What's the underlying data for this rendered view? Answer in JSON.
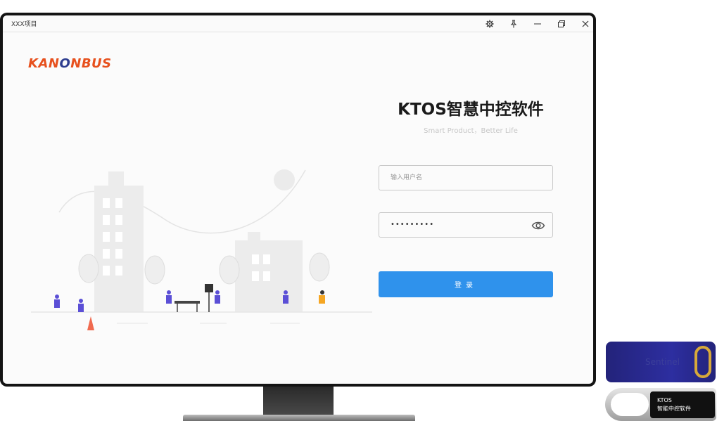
{
  "window": {
    "title": "XXX项目",
    "controls": [
      "gear-icon",
      "pin-icon",
      "minimize-icon",
      "restore-icon",
      "close-icon"
    ]
  },
  "brand": {
    "logo_left": "KAN",
    "logo_o": "O",
    "logo_right": "NBUS"
  },
  "login": {
    "title": "KTOS智慧中控软件",
    "slogan": "Smart Product，Better Life",
    "username_placeholder": "输入用户名",
    "password_mask": "•••••••••",
    "submit_label": "登录"
  },
  "hardware": {
    "dongle_brand": "Sentinel",
    "usb_label_line1": "KTOS",
    "usb_label_line2": "智能中控软件"
  },
  "colors": {
    "accent": "#2f92ec",
    "logo_orange": "#e7501d",
    "logo_blue": "#2e3d8f"
  }
}
